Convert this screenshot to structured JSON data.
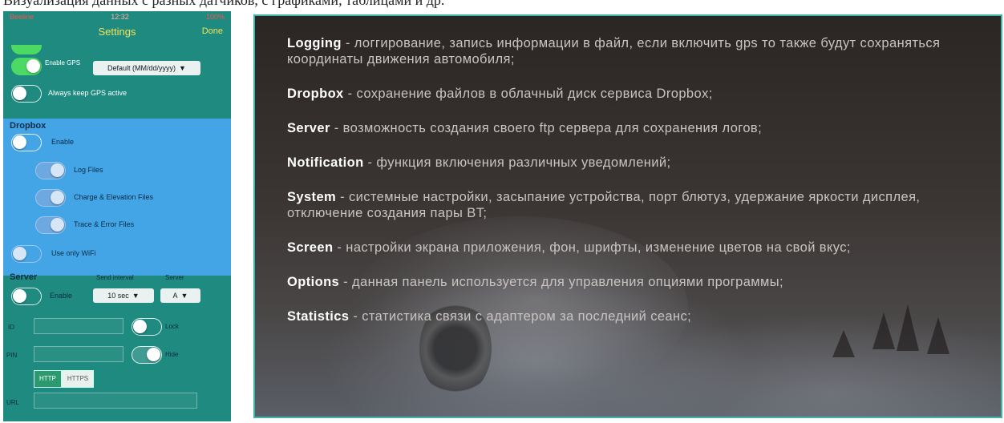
{
  "top_caption": "Визуализация данных с разных датчиков, с графиками, таблицами и др.",
  "phone": {
    "status": {
      "carrier": "Beeline",
      "time": "12:32",
      "battery": "100%"
    },
    "nav": {
      "title": "Settings",
      "done": "Done"
    },
    "gps": {
      "enable_label": "Enable GPS",
      "format_value": "Default (MM/dd/yyyy)",
      "always_active_label": "Always keep GPS active"
    },
    "dropbox": {
      "header": "Dropbox",
      "enable_label": "Enable",
      "log_files_label": "Log Files",
      "charge_files_label": "Charge & Elevation Files",
      "trace_files_label": "Trace & Error Files",
      "wifi_label": "Use only WiFi"
    },
    "server": {
      "header": "Server",
      "send_interval_label": "Send interval",
      "server_label": "Server",
      "enable_label": "Enable",
      "interval_value": "10 sec",
      "server_value": "A",
      "id_label": "ID",
      "pin_label": "PIN",
      "lock_label": "Lock",
      "hide_label": "Hide",
      "http_label": "HTTP",
      "https_label": "HTTPS",
      "url_label": "URL"
    },
    "chevron_icon": "chevron-down-icon"
  },
  "info": {
    "items": [
      {
        "name": "Logging",
        "text": " - логгирование, запись информации в файл, если включить gps то также будут сохраняться координаты движения автомобиля;"
      },
      {
        "name": "Dropbox",
        "text": " - сохранение файлов в облачный диск сервиса Dropbox;"
      },
      {
        "name": "Server",
        "text": " - возможность создания своего ftp сервера для сохранения логов;"
      },
      {
        "name": "Notification",
        "text": " - функция включения различных уведомлений;"
      },
      {
        "name": "System",
        "text": " - системные настройки, засыпание устройства, порт блютуз, удержание яркости дисплея, отключение создания пары BT;"
      },
      {
        "name": "Screen",
        "text": " - настройки экрана приложения, фон, шрифты, изменение цветов на свой вкус;"
      },
      {
        "name": "Options",
        "text": " - данная панель используется для управления опциями программы;"
      },
      {
        "name": "Statistics",
        "text": " - статистика связи с адаптером за последний сеанс;"
      }
    ]
  }
}
